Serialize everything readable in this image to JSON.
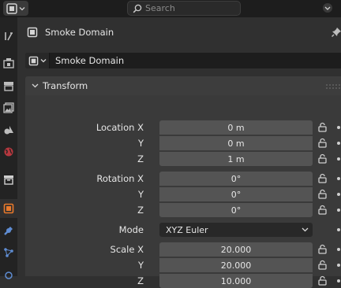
{
  "search": {
    "placeholder": "Search"
  },
  "object_header": {
    "title": "Smoke Domain"
  },
  "datablock": {
    "name": "Smoke Domain"
  },
  "transform": {
    "title": "Transform",
    "location": {
      "label_x": "Location X",
      "label_y": "Y",
      "label_z": "Z",
      "x": "0 m",
      "y": "0 m",
      "z": "1 m"
    },
    "rotation": {
      "label_x": "Rotation X",
      "label_y": "Y",
      "label_z": "Z",
      "x": "0°",
      "y": "0°",
      "z": "0°"
    },
    "mode": {
      "label": "Mode",
      "value": "XYZ Euler"
    },
    "scale": {
      "label_x": "Scale X",
      "label_y": "Y",
      "label_z": "Z",
      "x": "20.000",
      "y": "20.000",
      "z": "10.000"
    }
  },
  "colors": {
    "active_tab": "#e8792b",
    "panel": "#3a3a3a",
    "field": "#545454"
  }
}
